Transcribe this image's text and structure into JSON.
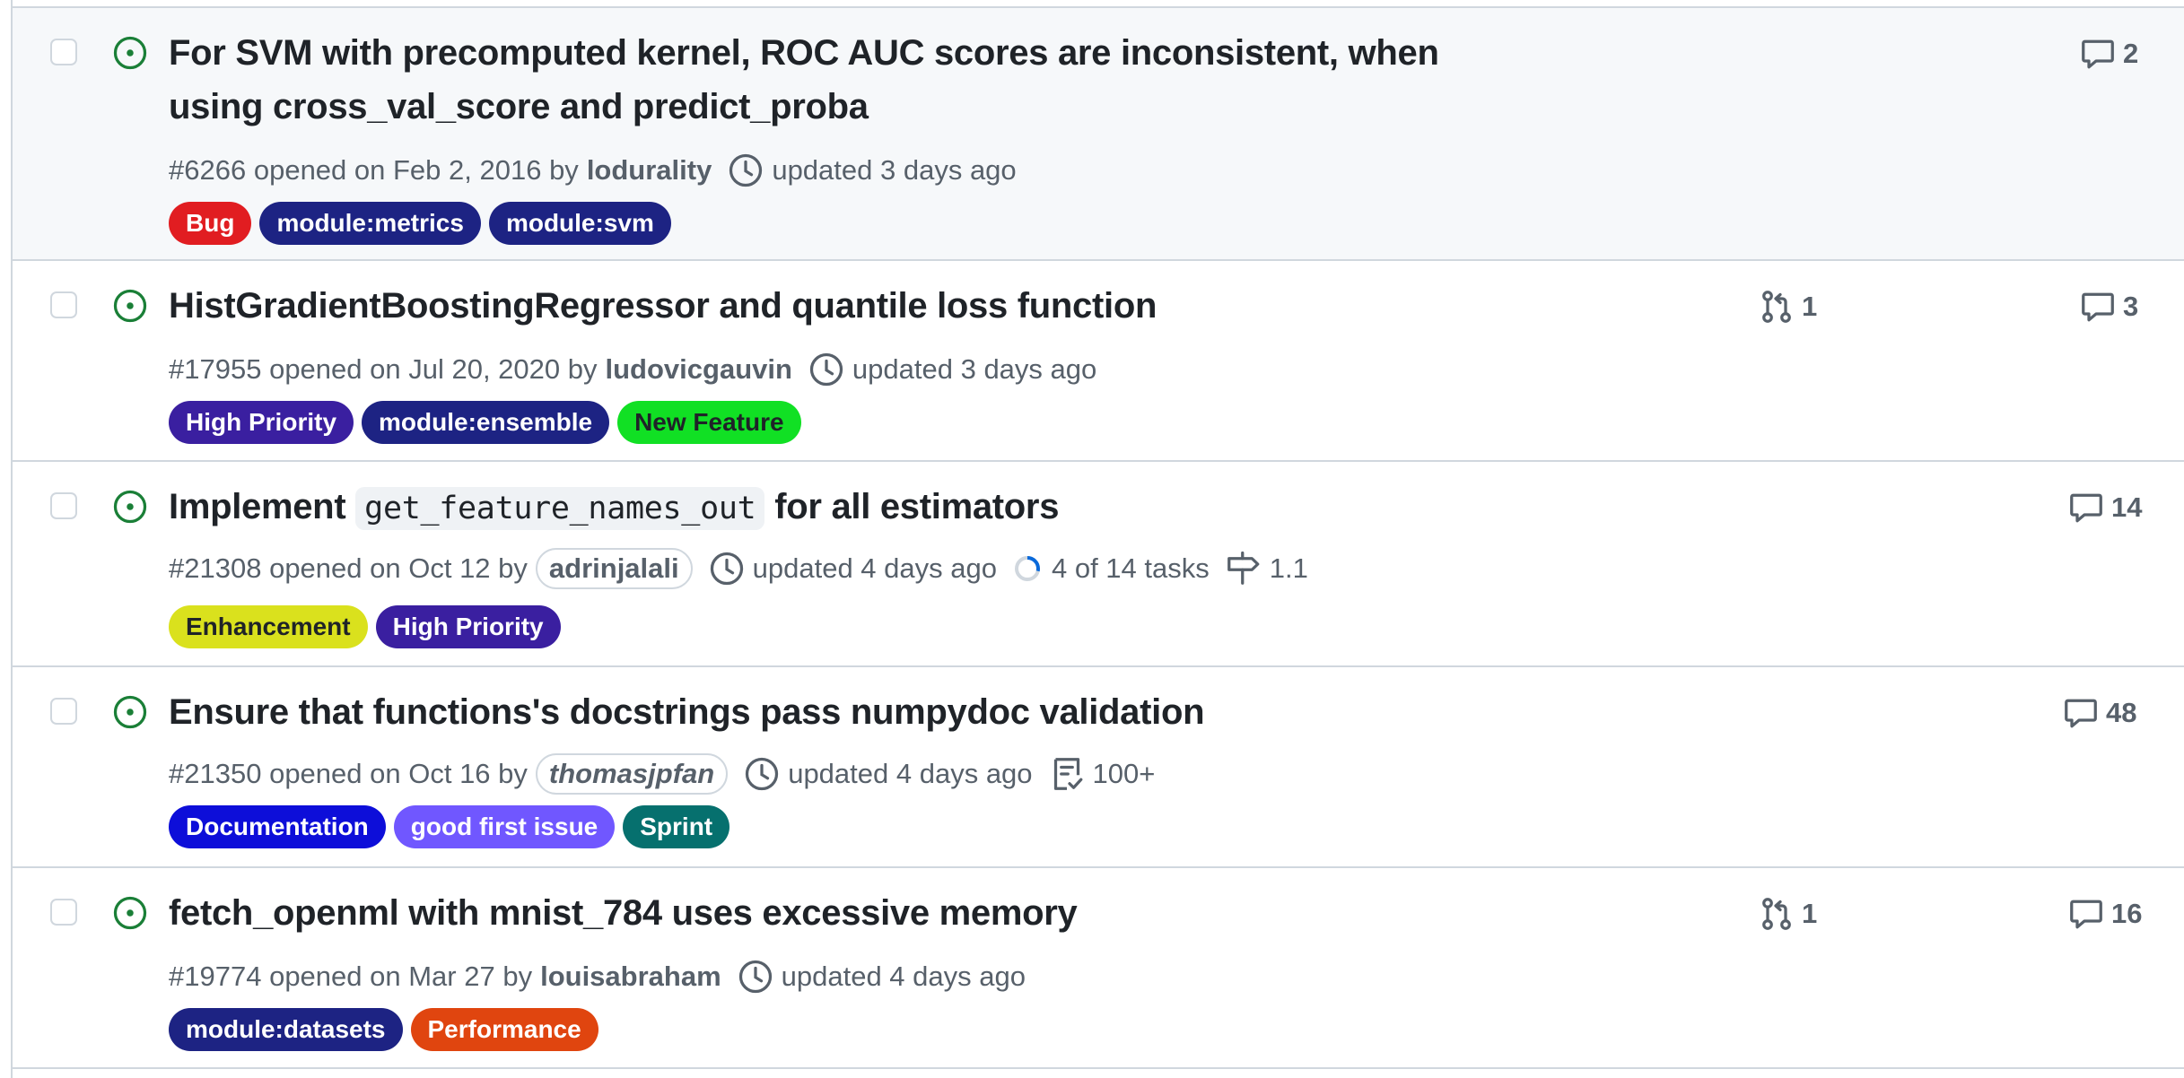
{
  "issues": [
    {
      "title": "For SVM with precomputed kernel, ROC AUC scores are inconsistent, when using cross_val_score and predict_proba",
      "number": "#6266",
      "opened_text": "opened on Feb 2, 2016 by",
      "author": "lodurality",
      "updated": "updated 3 days ago",
      "comments": "2",
      "labels": [
        {
          "text": "Bug",
          "bg": "#e11d21",
          "fg": "#ffffff"
        },
        {
          "text": "module:metrics",
          "bg": "#1d2383",
          "fg": "#ffffff"
        },
        {
          "text": "module:svm",
          "bg": "#1d2383",
          "fg": "#ffffff"
        }
      ]
    },
    {
      "title": "HistGradientBoostingRegressor and quantile loss function",
      "number": "#17955",
      "opened_text": "opened on Jul 20, 2020 by",
      "author": "ludovicgauvin",
      "updated": "updated 3 days ago",
      "linked_prs": "1",
      "comments": "3",
      "labels": [
        {
          "text": "High Priority",
          "bg": "#3a1fa0",
          "fg": "#ffffff"
        },
        {
          "text": "module:ensemble",
          "bg": "#1d2383",
          "fg": "#ffffff"
        },
        {
          "text": "New Feature",
          "bg": "#11e024",
          "fg": "#1f2328"
        }
      ]
    },
    {
      "title_before": "Implement",
      "title_code": "get_feature_names_out",
      "title_after": "for all estimators",
      "number": "#21308",
      "opened_text": "opened on Oct 12 by",
      "author": "adrinjalali",
      "updated": "updated 4 days ago",
      "tasks": "4 of 14 tasks",
      "tasks_progress": 0.2857,
      "milestone": "1.1",
      "comments": "14",
      "labels": [
        {
          "text": "Enhancement",
          "bg": "#dae11d",
          "fg": "#1f2328"
        },
        {
          "text": "High Priority",
          "bg": "#3a1fa0",
          "fg": "#ffffff"
        }
      ]
    },
    {
      "title": "Ensure that functions's docstrings pass numpydoc validation",
      "number": "#21350",
      "opened_text": "opened on Oct 16 by",
      "author": "thomasjpfan",
      "updated": "updated 4 days ago",
      "tracked": "100+",
      "comments": "48",
      "labels": [
        {
          "text": "Documentation",
          "bg": "#0d0ed9",
          "fg": "#ffffff"
        },
        {
          "text": "good first issue",
          "bg": "#7057ff",
          "fg": "#ffffff"
        },
        {
          "text": "Sprint",
          "bg": "#06706e",
          "fg": "#ffffff"
        }
      ]
    },
    {
      "title": "fetch_openml with mnist_784 uses excessive memory",
      "number": "#19774",
      "opened_text": "opened on Mar 27 by",
      "author": "louisabraham",
      "updated": "updated 4 days ago",
      "linked_prs": "1",
      "comments": "16",
      "labels": [
        {
          "text": "module:datasets",
          "bg": "#1d2383",
          "fg": "#ffffff"
        },
        {
          "text": "Performance",
          "bg": "#e0450f",
          "fg": "#ffffff"
        }
      ]
    }
  ],
  "colors": {
    "open_issue_green": "#1a7f37",
    "muted_text": "#57606a",
    "border": "#d0d7de",
    "highlight_bg": "#f6f8fa",
    "progress_blue": "#0969da"
  }
}
